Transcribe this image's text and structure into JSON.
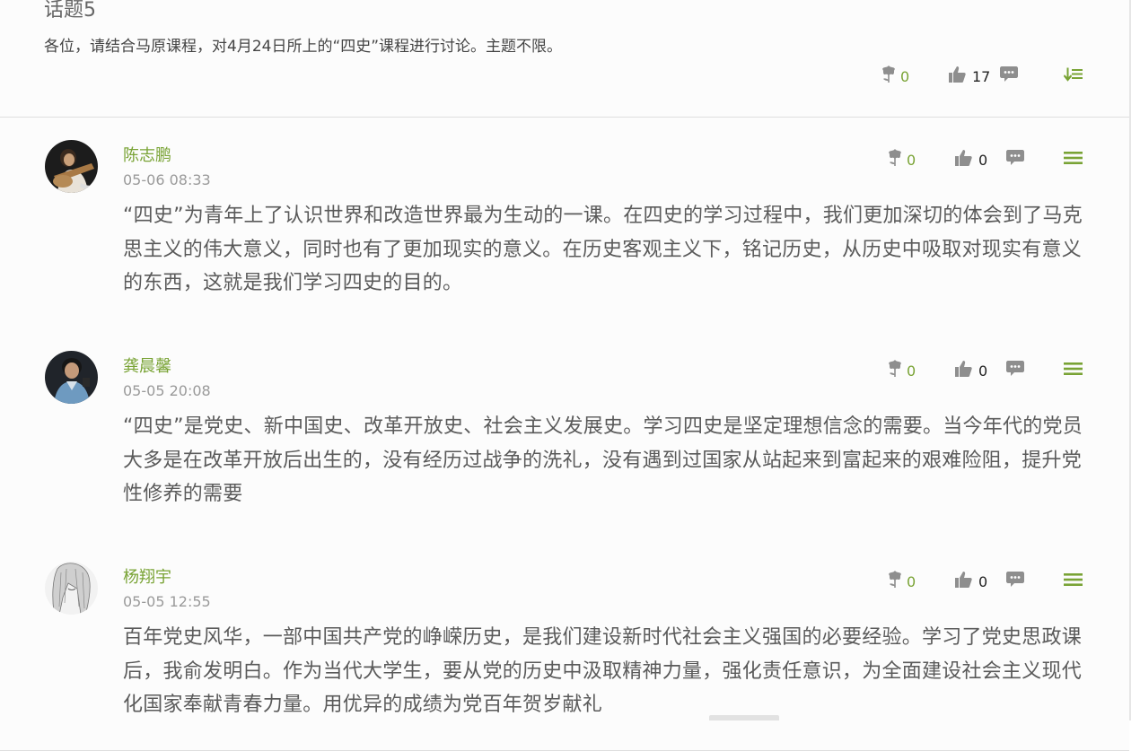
{
  "topic": {
    "title": "话题5",
    "description": "各位，请结合马原课程，对4月24日所上的“四史”课程进行讨论。主题不限。",
    "flower_count": "0",
    "like_count": "17"
  },
  "comments": [
    {
      "author": "陈志鹏",
      "time": "05-06 08:33",
      "content": "“四史”为青年上了认识世界和改造世界最为生动的一课。在四史的学习过程中，我们更加深切的体会到了马克思主义的伟大意义，同时也有了更加现实的意义。在历史客观主义下，铭记历史，从历史中吸取对现实有意义的东西，这就是我们学习四史的目的。",
      "flower_count": "0",
      "like_count": "0"
    },
    {
      "author": "龚晨馨",
      "time": "05-05 20:08",
      "content": "“四史”是党史、新中国史、改革开放史、社会主义发展史。学习四史是坚定理想信念的需要。当今年代的党员大多是在改革开放后出生的，没有经历过战争的洗礼，没有遇到过国家从站起来到富起来的艰难险阻，提升党性修养的需要",
      "flower_count": "0",
      "like_count": "0"
    },
    {
      "author": "杨翔宇",
      "time": "05-05 12:55",
      "content": "百年党史风华，一部中国共产党的峥嵘历史，是我们建设新时代社会主义强国的必要经验。学习了党史思政课后，我俞发明白。作为当代大学生，要从党的历史中汲取精神力量，强化责任意识，为全面建设社会主义现代化国家奉献青春力量。用优异的成绩为党百年贺岁献礼",
      "flower_count": "0",
      "like_count": "0"
    }
  ],
  "icons": {
    "flower": "flower-icon",
    "like": "thumbs-up-icon",
    "comment": "comment-bubble-icon",
    "sort": "sort-down-icon",
    "menu": "menu-icon"
  },
  "colors": {
    "accent_green": "#79a335",
    "icon_gray": "#8e8e8e",
    "text": "#5a5a5a",
    "divider": "#dedede"
  }
}
